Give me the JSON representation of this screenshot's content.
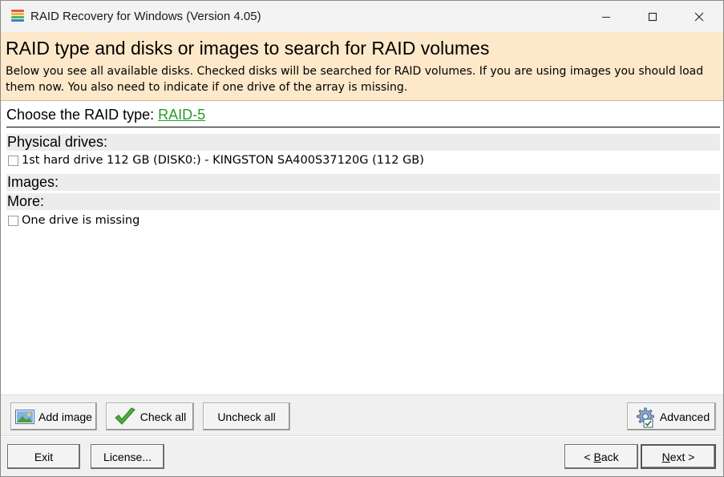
{
  "window": {
    "title": "RAID Recovery for Windows (Version 4.05)",
    "app_icon": "raid-stack-icon",
    "icon_colors": [
      "#e5574b",
      "#f2b632",
      "#4fb35b",
      "#3b82c4"
    ],
    "controls": [
      "minimize-icon",
      "maximize-icon",
      "close-icon"
    ]
  },
  "banner": {
    "title": "RAID type and disks or images to search for RAID volumes",
    "description": "Below you see all available disks. Checked disks will be searched for RAID volumes. If you are using images you should load them now. You also need to indicate if one drive of the array is missing.",
    "background": "#fde8c9"
  },
  "raid": {
    "label": "Choose the RAID type: ",
    "value": "RAID-5",
    "link_color": "#2a9a2a"
  },
  "sections": {
    "physical": {
      "label": "Physical drives:",
      "items": [
        {
          "label": "1st hard drive 112 GB (DISK0:) - KINGSTON SA400S37120G (112 GB)",
          "checked": false
        }
      ]
    },
    "images": {
      "label": "Images:"
    },
    "more": {
      "label": "More:",
      "items": [
        {
          "label": "One drive is missing",
          "checked": false
        }
      ]
    }
  },
  "toolbar": {
    "add_image": "Add image",
    "check_all": "Check all",
    "uncheck_all": "Uncheck all",
    "advanced": "Advanced"
  },
  "footer": {
    "exit": "Exit",
    "license": "License...",
    "back_prefix": "< ",
    "back_key": "B",
    "back_rest": "ack",
    "next_key": "N",
    "next_rest": "ext >"
  }
}
